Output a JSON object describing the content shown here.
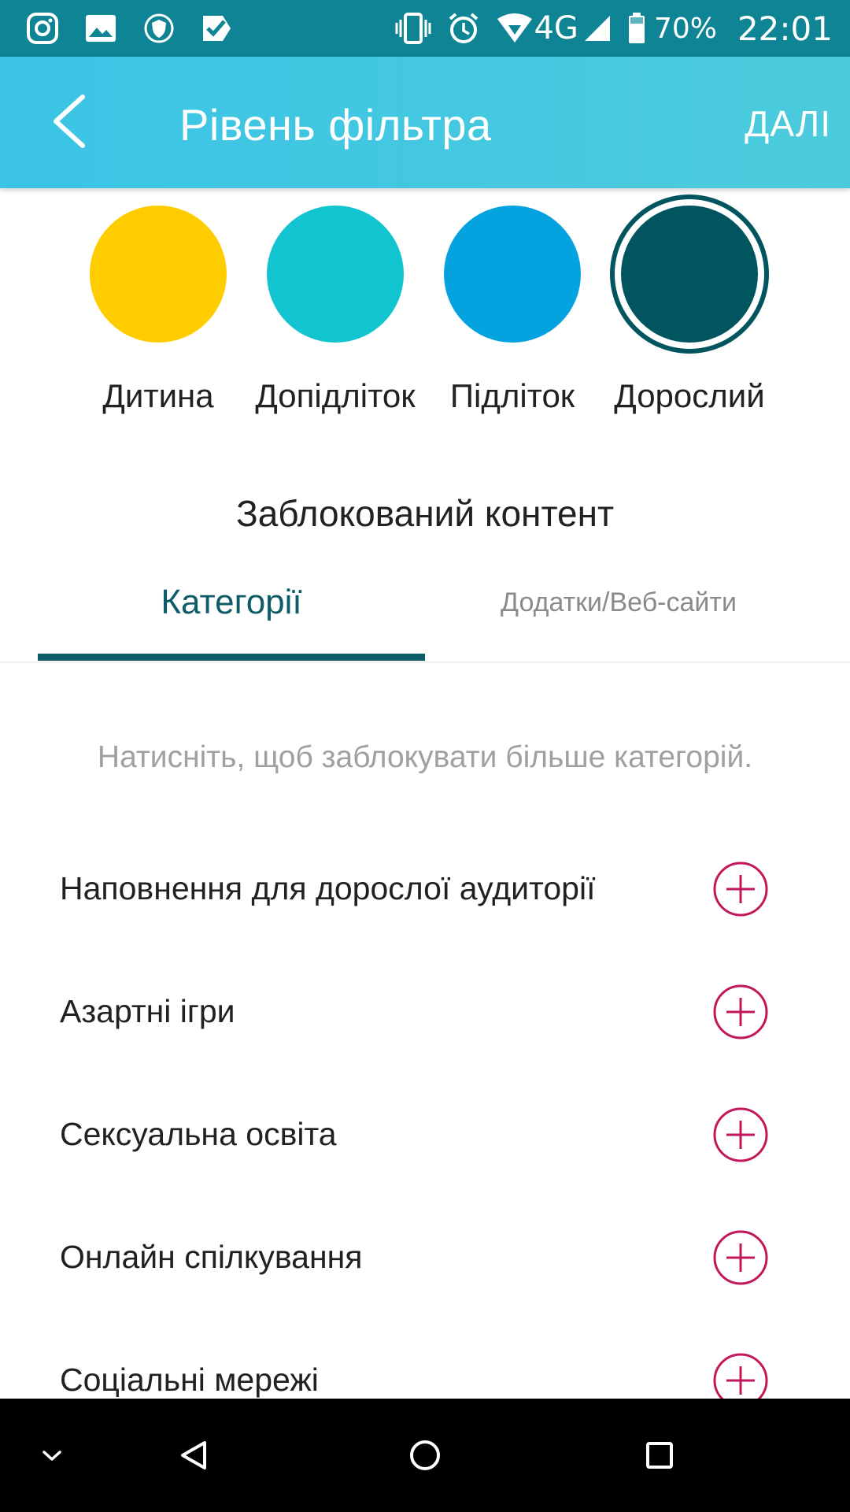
{
  "status_bar": {
    "left_icons": [
      "instagram-icon",
      "gallery-icon",
      "vpn-shield-icon",
      "task-check-icon"
    ],
    "network": "4G",
    "battery_percent": "70%",
    "time": "22:01"
  },
  "app_bar": {
    "title": "Рівень фільтра",
    "next_label": "ДАЛІ"
  },
  "levels": {
    "items": [
      {
        "label": "Дитина",
        "color": "#ffcc00"
      },
      {
        "label": "Допідліток",
        "color": "#12c4cf"
      },
      {
        "label": "Підліток",
        "color": "#04a3e0"
      },
      {
        "label": "Дорослий",
        "color": "#00555f"
      }
    ],
    "selected": "Дорослий"
  },
  "blocked_content": {
    "title": "Заблокований контент"
  },
  "tabs": [
    {
      "label": "Категорії",
      "active": true
    },
    {
      "label": "Додатки/Веб-сайти",
      "active": false
    }
  ],
  "hint": "Натисніть, щоб заблокувати більше категорій.",
  "categories": [
    {
      "label": "Наповнення для дорослої аудиторії"
    },
    {
      "label": "Азартні ігри"
    },
    {
      "label": "Сексуальна освіта"
    },
    {
      "label": "Онлайн спілкування"
    },
    {
      "label": "Соціальні мережі"
    }
  ],
  "colors": {
    "accent": "#0e5c68",
    "add_icon": "#c2185b",
    "app_bar": "#3bc4e6",
    "status_bar": "#0f8494"
  }
}
